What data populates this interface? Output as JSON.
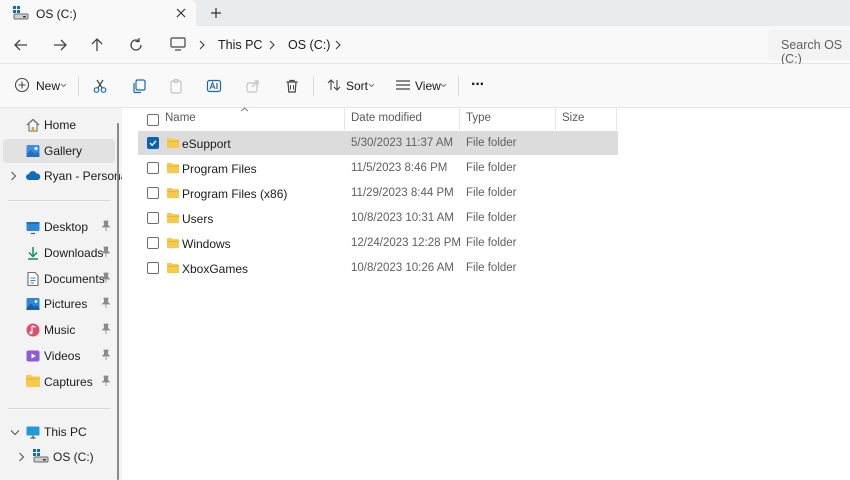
{
  "tab": {
    "title": "OS (C:)"
  },
  "address": {
    "crumbs": [
      "This PC",
      "OS (C:)"
    ],
    "search_placeholder": "Search OS (C:)"
  },
  "commands": {
    "new_label": "New",
    "sort_label": "Sort",
    "view_label": "View",
    "more_label": "···"
  },
  "sidebar": {
    "home": "Home",
    "gallery": "Gallery",
    "personal": "Ryan - Personal",
    "quick": [
      "Desktop",
      "Downloads",
      "Documents",
      "Pictures",
      "Music",
      "Videos",
      "Captures"
    ],
    "thispc": "This PC",
    "osc": "OS (C:)"
  },
  "columns": {
    "name": "Name",
    "date": "Date modified",
    "type": "Type",
    "size": "Size"
  },
  "files": [
    {
      "name": "eSupport",
      "date": "5/30/2023 11:37 AM",
      "type": "File folder"
    },
    {
      "name": "Program Files",
      "date": "11/5/2023 8:46 PM",
      "type": "File folder"
    },
    {
      "name": "Program Files (x86)",
      "date": "11/29/2023 8:44 PM",
      "type": "File folder"
    },
    {
      "name": "Users",
      "date": "10/8/2023 10:31 AM",
      "type": "File folder"
    },
    {
      "name": "Windows",
      "date": "12/24/2023 12:28 PM",
      "type": "File folder"
    },
    {
      "name": "XboxGames",
      "date": "10/8/2023 10:26 AM",
      "type": "File folder"
    }
  ],
  "colors": {
    "accent": "#0b5fb6",
    "folder": "#f8c94a",
    "selection": "#dcdcdc"
  }
}
